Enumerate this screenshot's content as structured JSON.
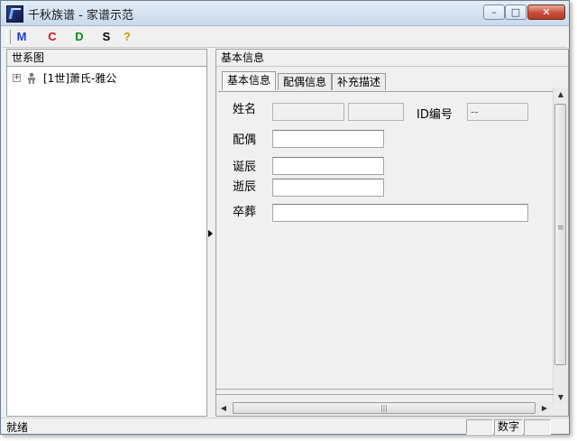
{
  "window": {
    "title": "千秋族谱 - 家谱示范",
    "buttons": {
      "minimize": "–",
      "maximize": "□",
      "close": "✕"
    }
  },
  "toolbar": {
    "items": [
      {
        "label": "M",
        "color": "#1a3ccf"
      },
      {
        "label": "C",
        "color": "#d01818"
      },
      {
        "label": "D",
        "color": "#0f8a18"
      },
      {
        "label": "S",
        "color": "#000000"
      },
      {
        "label": "?",
        "color": "#c9a000"
      }
    ]
  },
  "left_pane": {
    "header": "世系图",
    "tree": [
      {
        "expander": "+",
        "label": "[1世]萧氏-雅公"
      }
    ]
  },
  "right_pane": {
    "header": "基本信息",
    "tabs": [
      "基本信息",
      "配偶信息",
      "补充描述"
    ],
    "active_tab": "基本信息",
    "form": {
      "name_label": "姓名",
      "id_label": "ID编号",
      "id_value": "--",
      "spouse_label": "配偶",
      "birth_label": "诞辰",
      "death_label": "逝辰",
      "burial_label": "卒葬"
    }
  },
  "statusbar": {
    "text": "就绪",
    "indicator": "数字"
  }
}
